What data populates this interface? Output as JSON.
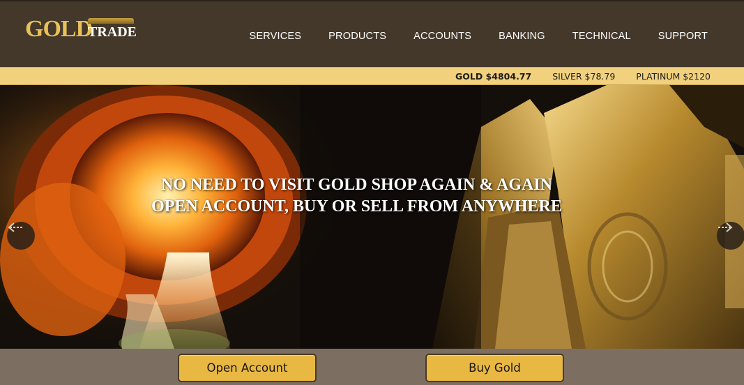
{
  "logo": {
    "word1": "GOLD",
    "word2": "TRADE"
  },
  "nav": [
    {
      "label": "SERVICES"
    },
    {
      "label": "PRODUCTS"
    },
    {
      "label": "ACCOUNTS"
    },
    {
      "label": "BANKING"
    },
    {
      "label": "TECHNICAL"
    },
    {
      "label": "SUPPORT"
    }
  ],
  "ticker": {
    "gold": "GOLD $4804.77",
    "silver": "SILVER $78.79",
    "platinum": "PLATINUM $2120"
  },
  "hero": {
    "line1": "NO NEED TO VISIT GOLD SHOP AGAIN & AGAIN",
    "line2": "OPEN ACCOUNT, BUY OR SELL FROM ANYWHERE",
    "prev_icon": "chevron-left-icon",
    "next_icon": "chevron-right-icon"
  },
  "cta": {
    "open_account": "Open Account",
    "buy_gold": "Buy Gold"
  },
  "colors": {
    "header_bg": "#44382a",
    "ticker_bg": "#f1d17e",
    "button_bg": "#e8b843",
    "cta_bar_bg": "#7c6f62",
    "logo_gold": "#e9c15a"
  }
}
